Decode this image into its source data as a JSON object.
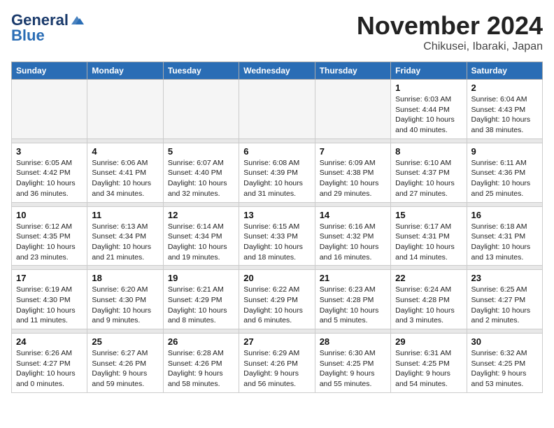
{
  "header": {
    "logo_line1": "General",
    "logo_line2": "Blue",
    "month_title": "November 2024",
    "location": "Chikusei, Ibaraki, Japan"
  },
  "weekdays": [
    "Sunday",
    "Monday",
    "Tuesday",
    "Wednesday",
    "Thursday",
    "Friday",
    "Saturday"
  ],
  "weeks": [
    [
      {
        "day": "",
        "info": ""
      },
      {
        "day": "",
        "info": ""
      },
      {
        "day": "",
        "info": ""
      },
      {
        "day": "",
        "info": ""
      },
      {
        "day": "",
        "info": ""
      },
      {
        "day": "1",
        "info": "Sunrise: 6:03 AM\nSunset: 4:44 PM\nDaylight: 10 hours and 40 minutes."
      },
      {
        "day": "2",
        "info": "Sunrise: 6:04 AM\nSunset: 4:43 PM\nDaylight: 10 hours and 38 minutes."
      }
    ],
    [
      {
        "day": "3",
        "info": "Sunrise: 6:05 AM\nSunset: 4:42 PM\nDaylight: 10 hours and 36 minutes."
      },
      {
        "day": "4",
        "info": "Sunrise: 6:06 AM\nSunset: 4:41 PM\nDaylight: 10 hours and 34 minutes."
      },
      {
        "day": "5",
        "info": "Sunrise: 6:07 AM\nSunset: 4:40 PM\nDaylight: 10 hours and 32 minutes."
      },
      {
        "day": "6",
        "info": "Sunrise: 6:08 AM\nSunset: 4:39 PM\nDaylight: 10 hours and 31 minutes."
      },
      {
        "day": "7",
        "info": "Sunrise: 6:09 AM\nSunset: 4:38 PM\nDaylight: 10 hours and 29 minutes."
      },
      {
        "day": "8",
        "info": "Sunrise: 6:10 AM\nSunset: 4:37 PM\nDaylight: 10 hours and 27 minutes."
      },
      {
        "day": "9",
        "info": "Sunrise: 6:11 AM\nSunset: 4:36 PM\nDaylight: 10 hours and 25 minutes."
      }
    ],
    [
      {
        "day": "10",
        "info": "Sunrise: 6:12 AM\nSunset: 4:35 PM\nDaylight: 10 hours and 23 minutes."
      },
      {
        "day": "11",
        "info": "Sunrise: 6:13 AM\nSunset: 4:34 PM\nDaylight: 10 hours and 21 minutes."
      },
      {
        "day": "12",
        "info": "Sunrise: 6:14 AM\nSunset: 4:34 PM\nDaylight: 10 hours and 19 minutes."
      },
      {
        "day": "13",
        "info": "Sunrise: 6:15 AM\nSunset: 4:33 PM\nDaylight: 10 hours and 18 minutes."
      },
      {
        "day": "14",
        "info": "Sunrise: 6:16 AM\nSunset: 4:32 PM\nDaylight: 10 hours and 16 minutes."
      },
      {
        "day": "15",
        "info": "Sunrise: 6:17 AM\nSunset: 4:31 PM\nDaylight: 10 hours and 14 minutes."
      },
      {
        "day": "16",
        "info": "Sunrise: 6:18 AM\nSunset: 4:31 PM\nDaylight: 10 hours and 13 minutes."
      }
    ],
    [
      {
        "day": "17",
        "info": "Sunrise: 6:19 AM\nSunset: 4:30 PM\nDaylight: 10 hours and 11 minutes."
      },
      {
        "day": "18",
        "info": "Sunrise: 6:20 AM\nSunset: 4:30 PM\nDaylight: 10 hours and 9 minutes."
      },
      {
        "day": "19",
        "info": "Sunrise: 6:21 AM\nSunset: 4:29 PM\nDaylight: 10 hours and 8 minutes."
      },
      {
        "day": "20",
        "info": "Sunrise: 6:22 AM\nSunset: 4:29 PM\nDaylight: 10 hours and 6 minutes."
      },
      {
        "day": "21",
        "info": "Sunrise: 6:23 AM\nSunset: 4:28 PM\nDaylight: 10 hours and 5 minutes."
      },
      {
        "day": "22",
        "info": "Sunrise: 6:24 AM\nSunset: 4:28 PM\nDaylight: 10 hours and 3 minutes."
      },
      {
        "day": "23",
        "info": "Sunrise: 6:25 AM\nSunset: 4:27 PM\nDaylight: 10 hours and 2 minutes."
      }
    ],
    [
      {
        "day": "24",
        "info": "Sunrise: 6:26 AM\nSunset: 4:27 PM\nDaylight: 10 hours and 0 minutes."
      },
      {
        "day": "25",
        "info": "Sunrise: 6:27 AM\nSunset: 4:26 PM\nDaylight: 9 hours and 59 minutes."
      },
      {
        "day": "26",
        "info": "Sunrise: 6:28 AM\nSunset: 4:26 PM\nDaylight: 9 hours and 58 minutes."
      },
      {
        "day": "27",
        "info": "Sunrise: 6:29 AM\nSunset: 4:26 PM\nDaylight: 9 hours and 56 minutes."
      },
      {
        "day": "28",
        "info": "Sunrise: 6:30 AM\nSunset: 4:25 PM\nDaylight: 9 hours and 55 minutes."
      },
      {
        "day": "29",
        "info": "Sunrise: 6:31 AM\nSunset: 4:25 PM\nDaylight: 9 hours and 54 minutes."
      },
      {
        "day": "30",
        "info": "Sunrise: 6:32 AM\nSunset: 4:25 PM\nDaylight: 9 hours and 53 minutes."
      }
    ]
  ]
}
